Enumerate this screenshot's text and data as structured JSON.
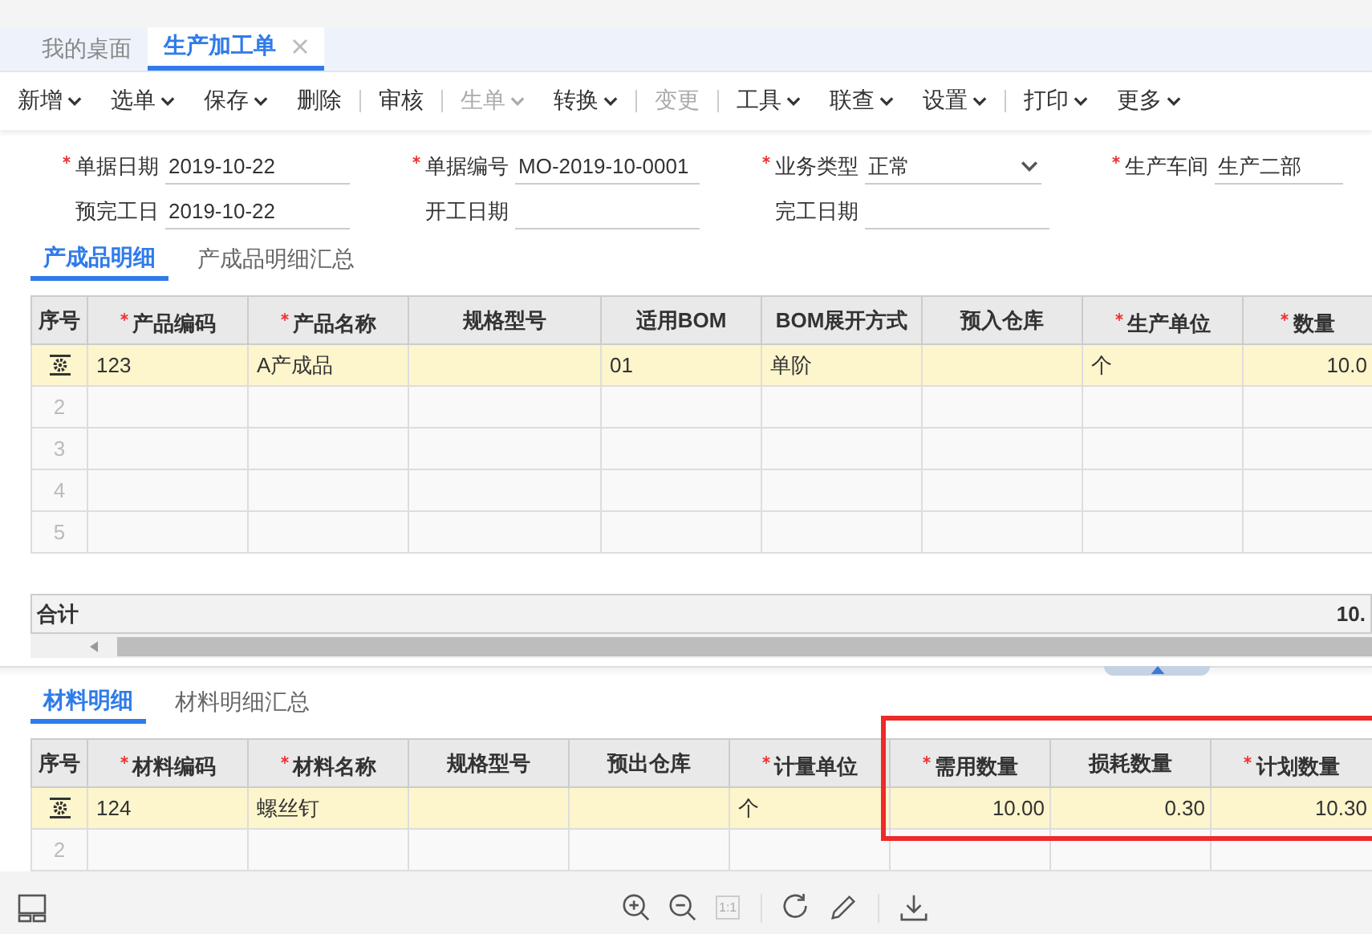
{
  "tabs": [
    {
      "label": "我的桌面",
      "selected": false,
      "closable": false
    },
    {
      "label": "生产加工单",
      "selected": true,
      "closable": true
    }
  ],
  "toolbar": [
    {
      "kind": "button",
      "label": "新增",
      "menu": true,
      "disabled": false
    },
    {
      "kind": "button",
      "label": "选单",
      "menu": true,
      "disabled": false
    },
    {
      "kind": "button",
      "label": "保存",
      "menu": true,
      "disabled": false
    },
    {
      "kind": "button",
      "label": "删除",
      "menu": false,
      "disabled": false
    },
    {
      "kind": "separator"
    },
    {
      "kind": "button",
      "label": "审核",
      "menu": false,
      "disabled": false
    },
    {
      "kind": "separator"
    },
    {
      "kind": "button",
      "label": "生单",
      "menu": true,
      "disabled": true
    },
    {
      "kind": "button",
      "label": "转换",
      "menu": true,
      "disabled": false
    },
    {
      "kind": "separator"
    },
    {
      "kind": "button",
      "label": "变更",
      "menu": false,
      "disabled": true
    },
    {
      "kind": "separator"
    },
    {
      "kind": "button",
      "label": "工具",
      "menu": true,
      "disabled": false
    },
    {
      "kind": "button",
      "label": "联查",
      "menu": true,
      "disabled": false
    },
    {
      "kind": "button",
      "label": "设置",
      "menu": true,
      "disabled": false
    },
    {
      "kind": "separator"
    },
    {
      "kind": "button",
      "label": "打印",
      "menu": true,
      "disabled": false
    },
    {
      "kind": "button",
      "label": "更多",
      "menu": true,
      "disabled": false
    }
  ],
  "form": [
    [
      {
        "label": "单据日期",
        "required": true,
        "value": "2019-10-22",
        "kind": "text"
      },
      {
        "label": "单据编号",
        "required": true,
        "value": "MO-2019-10-0001",
        "kind": "text"
      },
      {
        "label": "业务类型",
        "required": true,
        "value": "正常",
        "kind": "select"
      },
      {
        "label": "生产车间",
        "required": true,
        "value": "生产二部",
        "kind": "text"
      }
    ],
    [
      {
        "label": "预完工日",
        "required": false,
        "value": "2019-10-22",
        "kind": "text"
      },
      {
        "label": "开工日期",
        "required": false,
        "kind": "text"
      },
      {
        "label": "完工日期",
        "required": false,
        "kind": "text"
      }
    ]
  ],
  "product_section": {
    "tabs": [
      {
        "label": "产成品明细",
        "selected": true
      },
      {
        "label": "产成品明细汇总",
        "selected": false
      }
    ],
    "table": {
      "columns": [
        {
          "label": "序号",
          "required": false
        },
        {
          "label": "产品编码",
          "required": true,
          "numeric": false
        },
        {
          "label": "产品名称",
          "required": true,
          "numeric": false
        },
        {
          "label": "规格型号",
          "required": false
        },
        {
          "label": "适用BOM",
          "required": false,
          "numeric": false
        },
        {
          "label": "BOM展开方式",
          "required": false,
          "numeric": false
        },
        {
          "label": "预入仓库",
          "required": false
        },
        {
          "label": "生产单位",
          "required": true,
          "numeric": false
        },
        {
          "label": "数量",
          "required": true,
          "numeric": true
        }
      ],
      "rows": [
        {
          "selected": true,
          "cells": [
            "",
            "123",
            "A产成品",
            "",
            "01",
            "单阶",
            "",
            "个",
            "10.0"
          ]
        },
        {
          "selected": false,
          "cells": [
            "2",
            "",
            "",
            "",
            "",
            "",
            "",
            "",
            ""
          ]
        },
        {
          "selected": false,
          "cells": [
            "3",
            "",
            "",
            "",
            "",
            "",
            "",
            "",
            ""
          ]
        },
        {
          "selected": false,
          "cells": [
            "4",
            "",
            "",
            "",
            "",
            "",
            "",
            "",
            ""
          ]
        },
        {
          "selected": false,
          "cells": [
            "5",
            "",
            "",
            "",
            "",
            "",
            "",
            "",
            ""
          ]
        }
      ],
      "total": {
        "label": "合计",
        "value": "10."
      }
    }
  },
  "material_section": {
    "tabs": [
      {
        "label": "材料明细",
        "selected": true
      },
      {
        "label": "材料明细汇总",
        "selected": false
      }
    ],
    "table": {
      "columns": [
        {
          "label": "序号",
          "required": false
        },
        {
          "label": "材料编码",
          "required": true,
          "numeric": false
        },
        {
          "label": "材料名称",
          "required": true,
          "numeric": false
        },
        {
          "label": "规格型号",
          "required": false
        },
        {
          "label": "预出仓库",
          "required": false
        },
        {
          "label": "计量单位",
          "required": true,
          "numeric": false
        },
        {
          "label": "需用数量",
          "required": true,
          "numeric": true
        },
        {
          "label": "损耗数量",
          "required": false,
          "numeric": true
        },
        {
          "label": "计划数量",
          "required": true,
          "numeric": true
        }
      ],
      "rows": [
        {
          "selected": true,
          "cells": [
            "",
            "124",
            "螺丝钉",
            "",
            "",
            "个",
            "10.00",
            "0.30",
            "10.30"
          ]
        },
        {
          "selected": false,
          "cells": [
            "2",
            "",
            "",
            "",
            "",
            "",
            "",
            "",
            ""
          ]
        }
      ]
    }
  },
  "viewer_bar": {
    "actual_size": "1:1"
  }
}
